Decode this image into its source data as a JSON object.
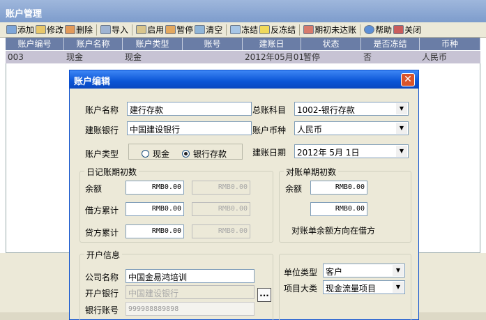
{
  "window": {
    "title": "账户管理"
  },
  "toolbar": {
    "buttons": [
      {
        "label": "添加",
        "icon": "add-icon"
      },
      {
        "label": "修改",
        "icon": "edit-icon"
      },
      {
        "label": "删除",
        "icon": "delete-icon"
      },
      {
        "label": "导入",
        "icon": "import-icon"
      },
      {
        "label": "启用",
        "icon": "enable-icon"
      },
      {
        "label": "暂停",
        "icon": "pause-icon"
      },
      {
        "label": "清空",
        "icon": "clear-icon"
      },
      {
        "label": "冻结",
        "icon": "freeze-icon"
      },
      {
        "label": "反冻结",
        "icon": "unfreeze-icon"
      },
      {
        "label": "期初未达账",
        "icon": "ledger-icon"
      },
      {
        "label": "帮助",
        "icon": "help-icon"
      },
      {
        "label": "关闭",
        "icon": "close-icon"
      }
    ]
  },
  "grid": {
    "columns": [
      "账户编号",
      "账户名称",
      "账户类型",
      "账号",
      "建账日",
      "状态",
      "是否冻结",
      "币种"
    ],
    "rows": [
      [
        "003",
        "现金",
        "现金",
        "",
        "2012年05月01",
        "暂停",
        "否",
        "人民币"
      ]
    ]
  },
  "dialog": {
    "title": "账户编辑",
    "close_glyph": "✕",
    "account_name_label": "账户名称",
    "account_name": "建行存款",
    "bank_label": "建账银行",
    "bank": "中国建设银行",
    "gl_label": "总账科目",
    "gl_value": "1002-银行存款",
    "currency_label": "账户币种",
    "currency": "人民币",
    "type_label": "账户类型",
    "type_cash": "现金",
    "type_bank": "银行存款",
    "date_label": "建账日期",
    "date_value": "2012年 5月 1日",
    "journal_group": "日记账期初数",
    "balance_label": "余额",
    "debit_label": "借方累计",
    "credit_label": "贷方累计",
    "balance": "RMB0.00",
    "balance_alt": "RMB0.00",
    "debit": "RMB0.00",
    "debit_alt": "RMB0.00",
    "credit": "RMB0.00",
    "credit_alt": "RMB0.00",
    "statement_group": "对账单期初数",
    "stmt_balance_label": "余额",
    "stmt_balance": "RMB0.00",
    "stmt_balance2": "RMB0.00",
    "stmt_note": "对账单余额方向在借方",
    "open_group": "开户信息",
    "company_label": "公司名称",
    "company": "中国金易鸿培训",
    "open_bank_label": "开户银行",
    "open_bank": "中国建设银行",
    "account_no_label": "银行账号",
    "account_no": "999988889898",
    "ellipsis": "...",
    "unit_type_label": "单位类型",
    "unit_type": "客户",
    "project_label": "项目大类",
    "project": "现金流量项目"
  }
}
